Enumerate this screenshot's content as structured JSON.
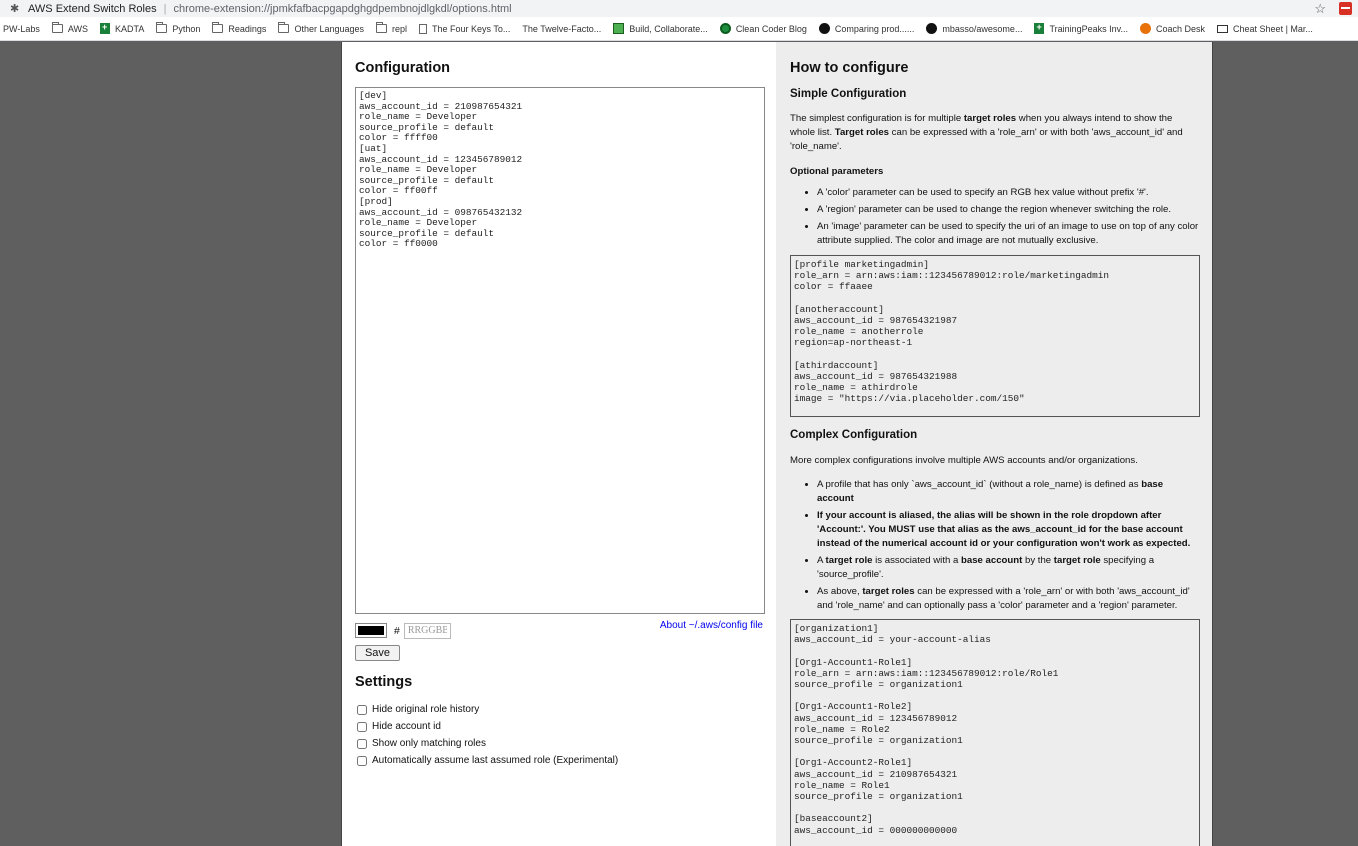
{
  "browser": {
    "tab_title": "AWS Extend Switch Roles",
    "url": "chrome-extension://jpmkfafbacpgapdghgdpembnojdlgkdl/options.html",
    "bookmarks": [
      {
        "label": "PW-Labs",
        "icon": "none"
      },
      {
        "label": "AWS",
        "icon": "folder"
      },
      {
        "label": "KADTA",
        "icon": "sheet"
      },
      {
        "label": "Python",
        "icon": "folder"
      },
      {
        "label": "Readings",
        "icon": "folder"
      },
      {
        "label": "Other Languages",
        "icon": "folder"
      },
      {
        "label": "repl",
        "icon": "folder"
      },
      {
        "label": "The Four Keys To...",
        "icon": "doc"
      },
      {
        "label": "The Twelve-Facto...",
        "icon": "none"
      },
      {
        "label": "Build, Collaborate...",
        "icon": "build"
      },
      {
        "label": "Clean Coder Blog",
        "icon": "green"
      },
      {
        "label": "Comparing prod......",
        "icon": "gh"
      },
      {
        "label": "mbasso/awesome...",
        "icon": "gh"
      },
      {
        "label": "TrainingPeaks Inv...",
        "icon": "sheet"
      },
      {
        "label": "Coach Desk",
        "icon": "coach"
      },
      {
        "label": "Cheat Sheet | Mar...",
        "icon": "cheat"
      }
    ]
  },
  "config": {
    "heading": "Configuration",
    "text": "[dev]\naws_account_id = 210987654321\nrole_name = Developer\nsource_profile = default\ncolor = ffff00\n[uat]\naws_account_id = 123456789012\nrole_name = Developer\nsource_profile = default\ncolor = ff00ff\n[prod]\naws_account_id = 098765432132\nrole_name = Developer\nsource_profile = default\ncolor = ff0000",
    "color_swatch": "#000000",
    "hash": "#",
    "color_placeholder": "RRGGBB",
    "about_link": "About ~/.aws/config file",
    "save_label": "Save"
  },
  "settings": {
    "heading": "Settings",
    "options": [
      {
        "label": "Hide original role history",
        "checked": false
      },
      {
        "label": "Hide account id",
        "checked": false
      },
      {
        "label": "Show only matching roles",
        "checked": false
      },
      {
        "label": "Automatically assume last assumed role (Experimental)",
        "checked": false
      }
    ]
  },
  "help": {
    "heading": "How to configure",
    "simple": {
      "heading": "Simple Configuration",
      "optional_heading": "Optional parameters",
      "code": "[profile marketingadmin]\nrole_arn = arn:aws:iam::123456789012:role/marketingadmin\ncolor = ffaaee\n\n[anotheraccount]\naws_account_id = 987654321987\nrole_name = anotherrole\nregion=ap-northeast-1\n\n[athirdaccount]\naws_account_id = 987654321988\nrole_name = athirdrole\nimage = \"https://via.placeholder.com/150\""
    },
    "complex": {
      "heading": "Complex Configuration",
      "intro": "More complex configurations involve multiple AWS accounts and/or organizations.",
      "code": "[organization1]\naws_account_id = your-account-alias\n\n[Org1-Account1-Role1]\nrole_arn = arn:aws:iam::123456789012:role/Role1\nsource_profile = organization1\n\n[Org1-Account1-Role2]\naws_account_id = 123456789012\nrole_name = Role2\nsource_profile = organization1\n\n[Org1-Account2-Role1]\naws_account_id = 210987654321\nrole_name = Role1\nsource_profile = organization1\n\n[baseaccount2]\naws_account_id = 000000000000"
    }
  }
}
